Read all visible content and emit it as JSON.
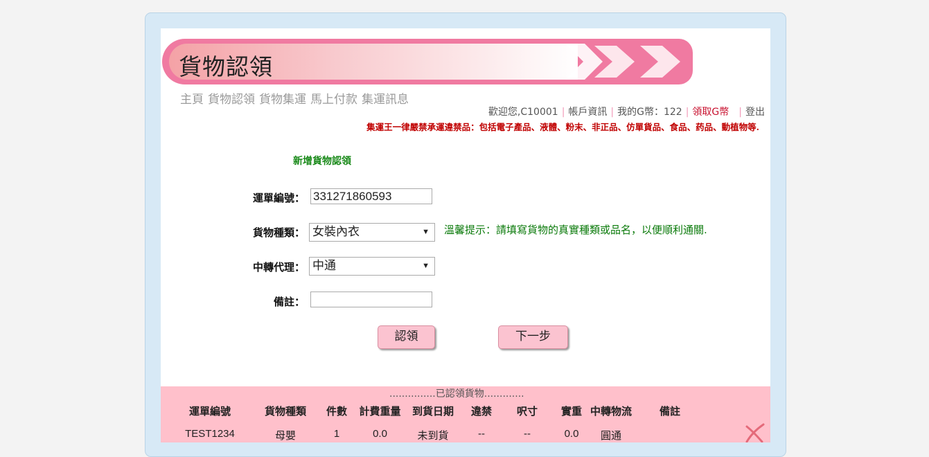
{
  "page": {
    "title": "貨物認領"
  },
  "nav": {
    "items": [
      "主頁",
      "貨物認領",
      "貨物集運",
      "馬上付款",
      "集運訊息"
    ]
  },
  "user_bar": {
    "welcome": "歡迎您,C10001",
    "account_info": "帳戶資訊",
    "my_coins": "我的G幣：122",
    "get_coins": "領取G幣",
    "logout": "登出"
  },
  "warning": "集運王一律嚴禁承運違禁品：包括電子產品、液體、粉末、非正品、仿單貨品、食品、药品、動植物等.",
  "form": {
    "title": "新增貨物認領",
    "tracking_label": "運單編號：",
    "tracking_value": "331271860593",
    "category_label": "貨物種類：",
    "category_value": "女裝內衣",
    "hint": "溫馨提示：請填寫貨物的真實種類或品名，以便順利通關.",
    "agent_label": "中轉代理：",
    "agent_value": "中通",
    "remark_label": "備註：",
    "remark_value": "",
    "claim_button": "認領",
    "next_button": "下一步"
  },
  "claimed": {
    "title": "...............已認領貨物.............",
    "columns": [
      "運單編號",
      "貨物種類",
      "件數",
      "計費重量",
      "到貨日期",
      "違禁",
      "呎寸",
      "實重",
      "中轉物流",
      "備註"
    ],
    "rows": [
      [
        "TEST1234",
        "母嬰",
        "1",
        "0.0",
        "未到貨",
        "--",
        "--",
        "0.0",
        "圓通",
        ""
      ]
    ]
  },
  "colors": {
    "background": "#f3f3f3",
    "frame": "#d7e9f6",
    "banner": "#f07aa1",
    "accent_pink": "#ffc0cb",
    "warning_red": "#c00000",
    "form_green": "#1a8a1a"
  }
}
